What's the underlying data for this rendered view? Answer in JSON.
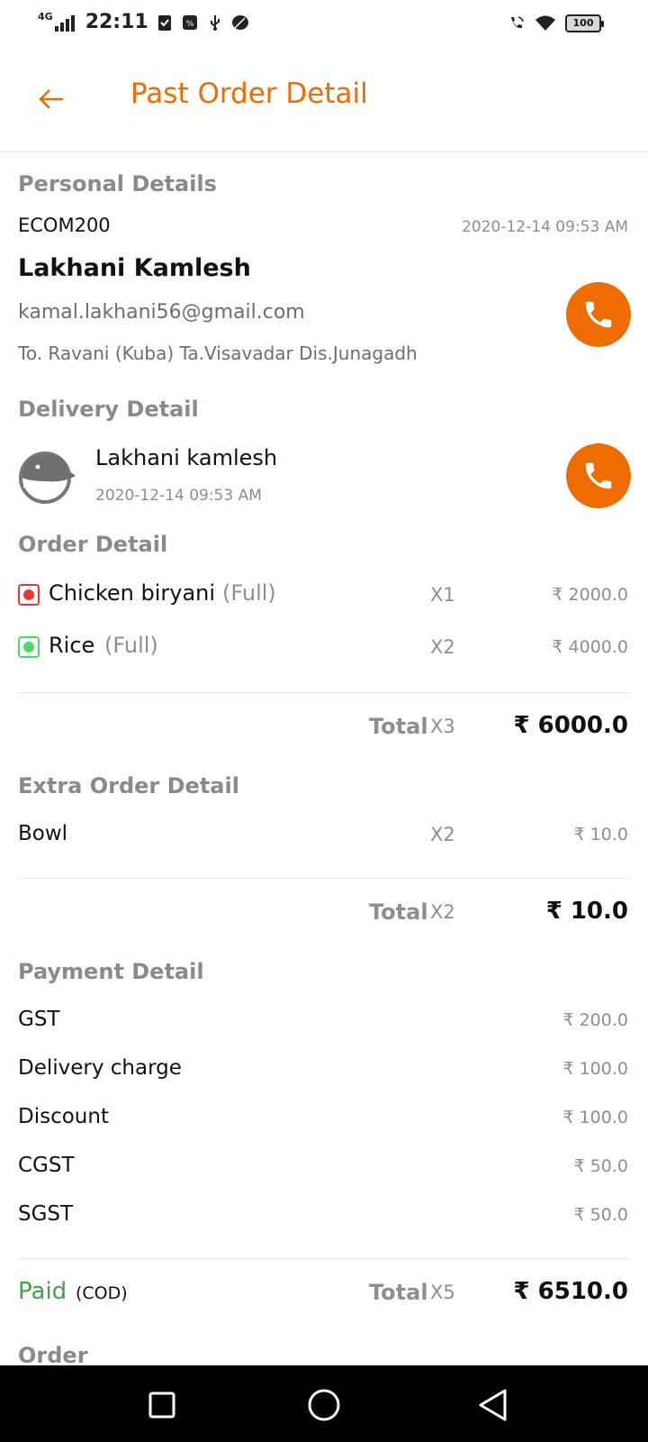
{
  "status_bar": {
    "network": "4G",
    "time": "22:11",
    "battery": "100"
  },
  "header": {
    "title": "Past Order Detail"
  },
  "personal": {
    "heading": "Personal Details",
    "order_id": "ECOM200",
    "datetime": "2020-12-14 09:53 AM",
    "name": "Lakhani Kamlesh",
    "email": "kamal.lakhani56@gmail.com",
    "address": "To. Ravani (Kuba) Ta.Visavadar Dis.Junagadh"
  },
  "delivery": {
    "heading": "Delivery Detail",
    "name": "Lakhani kamlesh",
    "datetime": "2020-12-14 09:53 AM"
  },
  "order": {
    "heading": "Order Detail",
    "items": [
      {
        "name": "Chicken biryani",
        "variant": "(Full)",
        "qty": "X1",
        "price": "₹ 2000.0",
        "type": "non-veg",
        "color": "#e53935"
      },
      {
        "name": "Rice",
        "variant": "(Full)",
        "qty": "X2",
        "price": "₹ 4000.0",
        "type": "veg",
        "color": "#4cd964"
      }
    ],
    "total_label": "Total",
    "total_qty": "X3",
    "total_amount": "₹ 6000.0"
  },
  "extra": {
    "heading": "Extra Order Detail",
    "items": [
      {
        "name": "Bowl",
        "qty": "X2",
        "price": "₹ 10.0"
      }
    ],
    "total_label": "Total",
    "total_qty": "X2",
    "total_amount": "₹ 10.0"
  },
  "payment": {
    "heading": "Payment Detail",
    "rows": [
      {
        "label": "GST",
        "value": "₹ 200.0"
      },
      {
        "label": "Delivery charge",
        "value": "₹ 100.0"
      },
      {
        "label": "Discount",
        "value": "₹ 100.0"
      },
      {
        "label": "CGST",
        "value": "₹ 50.0"
      },
      {
        "label": "SGST",
        "value": "₹ 50.0"
      }
    ],
    "status": "Paid",
    "method": "(COD)",
    "total_label": "Total",
    "total_qty": "X5",
    "total_amount": "₹ 6510.0"
  },
  "next_section": "Order",
  "colors": {
    "accent": "#ef6c00",
    "paid": "#43a047",
    "muted": "#8e8e8e"
  }
}
